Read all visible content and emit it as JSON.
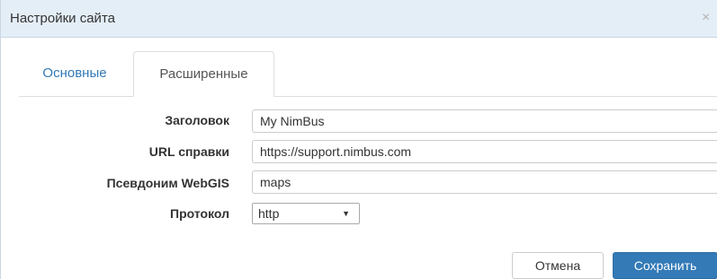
{
  "dialog": {
    "title": "Настройки сайта",
    "close_symbol": "×"
  },
  "tabs": [
    {
      "label": "Основные",
      "active": false
    },
    {
      "label": "Расширенные",
      "active": true
    }
  ],
  "form": {
    "title_label": "Заголовок",
    "title_value": "My NimBus",
    "help_url_label": "URL справки",
    "help_url_value": "https://support.nimbus.com",
    "webgis_alias_label": "Псевдоним WebGIS",
    "webgis_alias_value": "maps",
    "protocol_label": "Протокол",
    "protocol_value": "http"
  },
  "buttons": {
    "cancel_label": "Отмена",
    "save_label": "Сохранить"
  },
  "colors": {
    "accent": "#337ab7",
    "titlebar": "#e4eef7"
  },
  "icons": {
    "close": "close-icon",
    "dropdown": "chevron-down-icon"
  }
}
